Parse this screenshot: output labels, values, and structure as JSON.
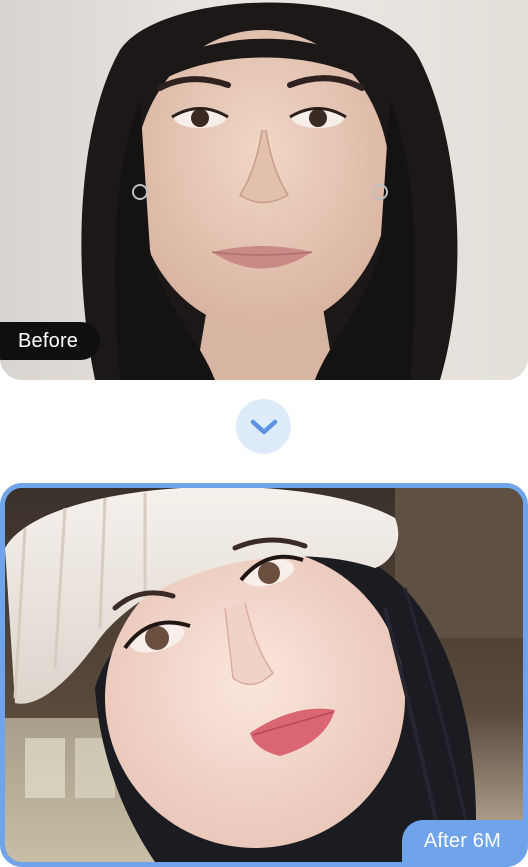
{
  "before": {
    "label": "Before"
  },
  "after": {
    "label": "After 6M"
  },
  "divider": {
    "icon": "chevron-down-icon"
  },
  "colors": {
    "accent": "#6fa3ea",
    "arrow_bg": "#deebfa",
    "arrow_fg": "#5b93e0",
    "before_label_bg": "#0f0f10"
  }
}
